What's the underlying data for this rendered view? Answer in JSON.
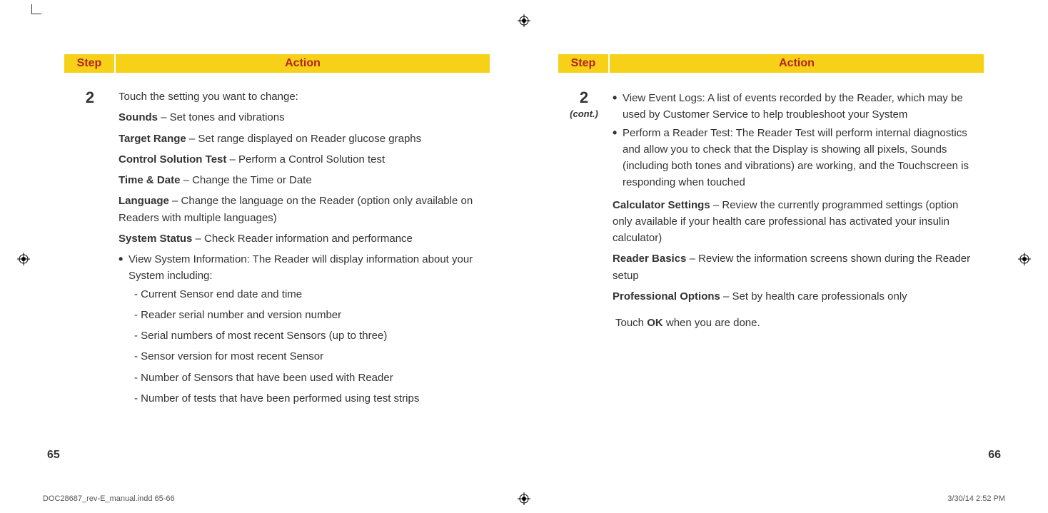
{
  "left": {
    "header": {
      "step": "Step",
      "action": "Action"
    },
    "step": "2",
    "pageNum": "65",
    "intro": "Touch the setting you want to change:",
    "settings": [
      {
        "name": "Sounds",
        "desc": " – Set tones and vibrations"
      },
      {
        "name": "Target Range",
        "desc": " – Set range displayed on Reader glucose graphs"
      },
      {
        "name": "Control Solution Test",
        "desc": " – Perform a Control Solution test"
      },
      {
        "name": "Time & Date",
        "desc": " – Change the Time or Date"
      },
      {
        "name": "Language",
        "desc": " – Change the language on the Reader (option only available on Readers with multiple languages)"
      },
      {
        "name": "System Status",
        "desc": " – Check Reader information and performance"
      }
    ],
    "bullets": [
      "View System Information: The Reader will display information about your System including:"
    ],
    "dashes": [
      "- Current Sensor end date and time",
      "- Reader serial number and version number",
      "- Serial numbers of most recent Sensors (up to three)",
      "- Sensor version for most recent Sensor",
      "- Number of Sensors that have been used with Reader",
      "- Number of tests that have been performed using test strips"
    ]
  },
  "right": {
    "header": {
      "step": "Step",
      "action": "Action"
    },
    "step": "2",
    "cont": "(cont.)",
    "pageNum": "66",
    "bullets": [
      "View Event Logs: A list of events recorded by the Reader, which may be used by Customer Service to help troubleshoot your System",
      "Perform a Reader Test: The Reader Test will perform internal diagnostics and allow you to check that the Display is showing all pixels, Sounds (including both tones and vibrations) are working, and the Touchscreen is responding when touched"
    ],
    "settings": [
      {
        "name": "Calculator Settings",
        "desc": " – Review the currently programmed settings (option only available if your health care professional has activated your insulin calculator)"
      },
      {
        "name": "Reader Basics",
        "desc": " – Review the information screens shown during the Reader setup"
      },
      {
        "name": "Professional Options",
        "desc": " – Set by health care professionals only"
      }
    ],
    "closing": {
      "pre": "Touch ",
      "bold": "OK",
      "post": " when you are done."
    }
  },
  "footer": {
    "file": "DOC28687_rev-E_manual.indd   65-66",
    "timestamp": "3/30/14   2:52 PM"
  }
}
